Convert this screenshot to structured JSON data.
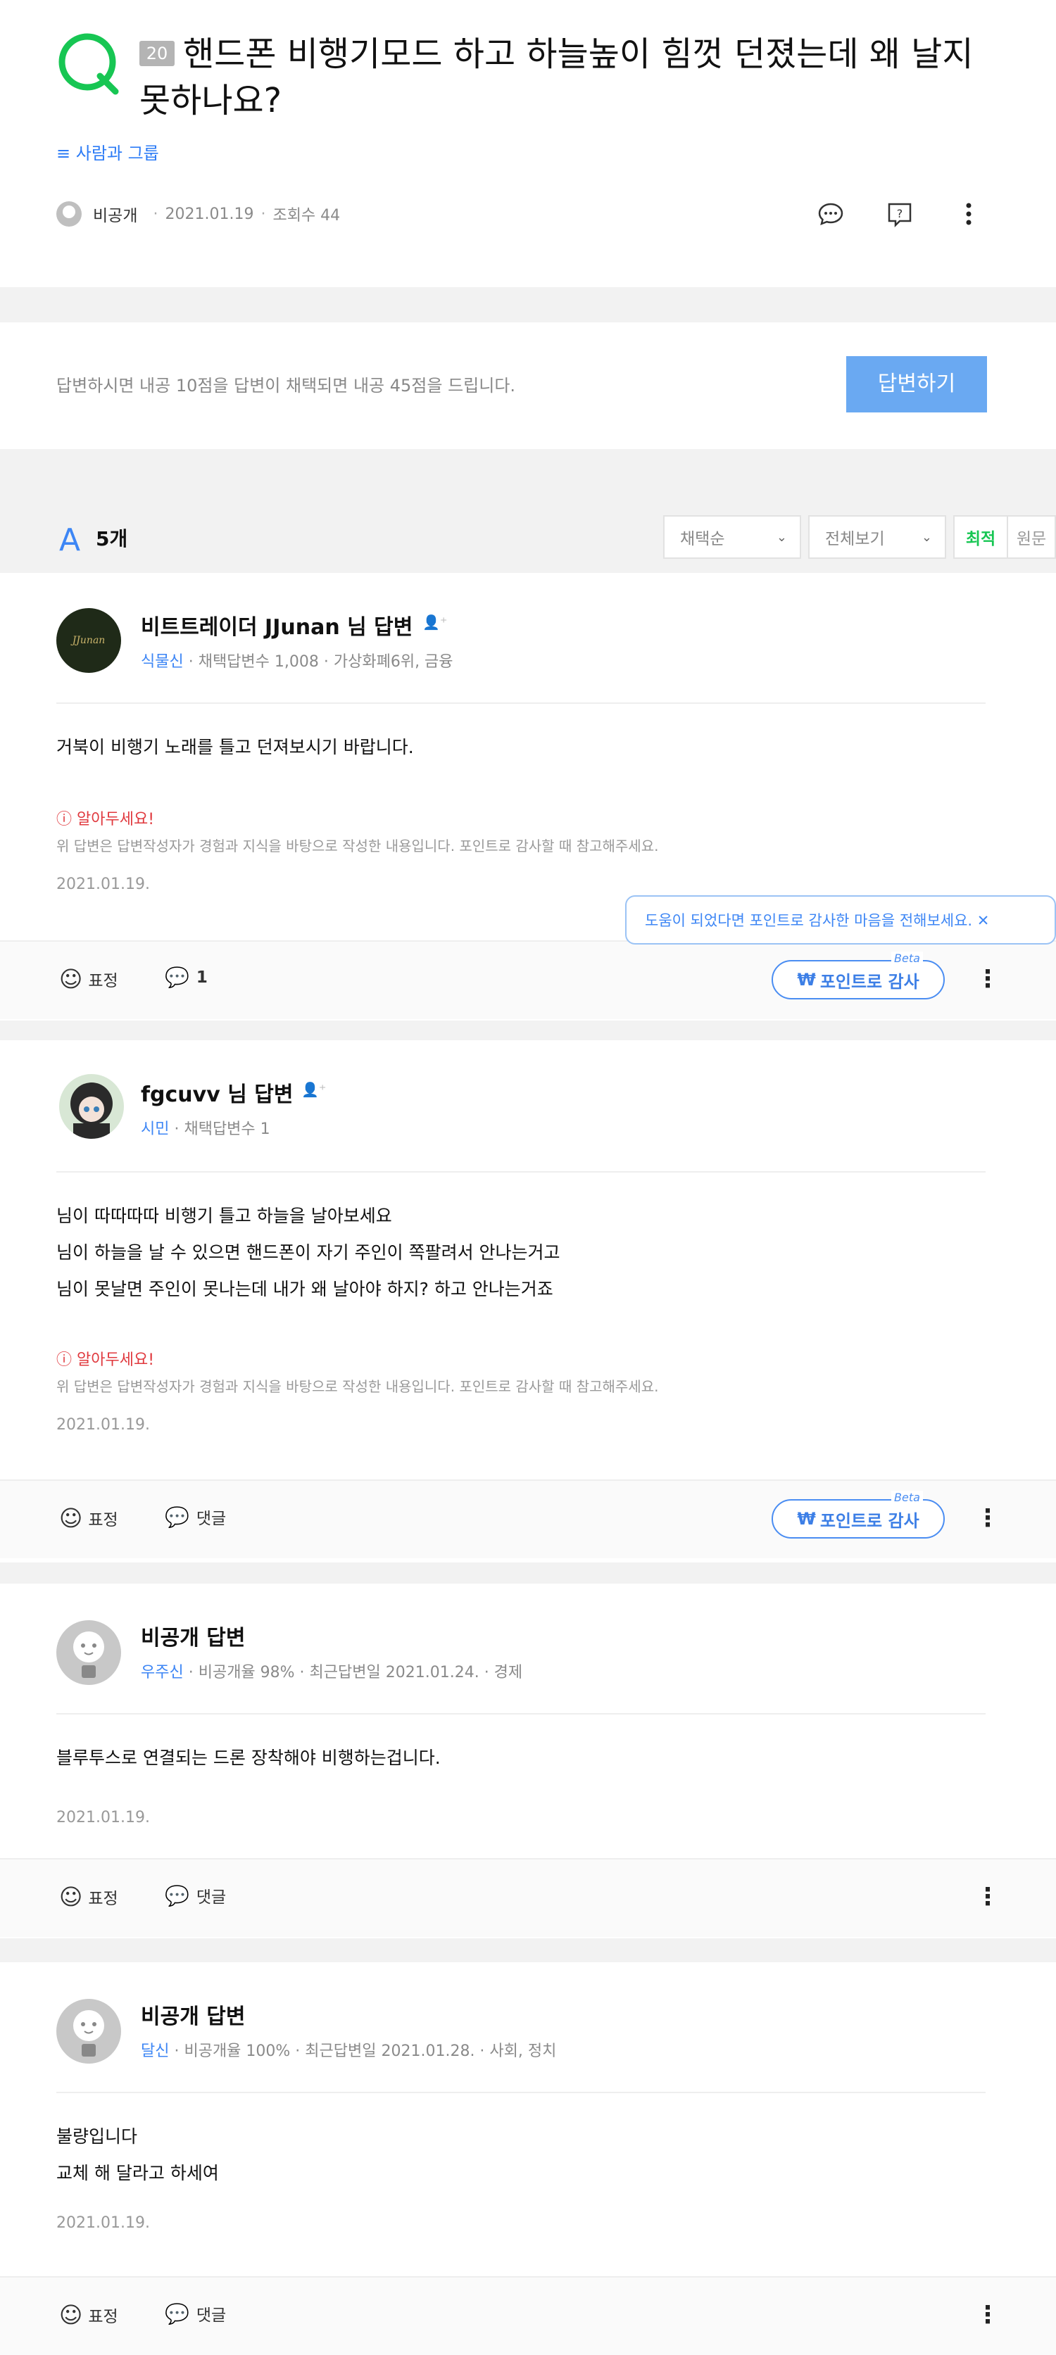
{
  "question": {
    "badge": "20",
    "title": "핸드폰 비행기모드 하고 하늘높이 힘껏 던졌는데 왜 날지못하나요?",
    "category": "≡ 사람과 그룹",
    "author": "비공개",
    "date": "2021.01.19",
    "views": "조회수 44"
  },
  "prompt": {
    "text": "답변하시면 내공 10점을 답변이 채택되면 내공 45점을 드립니다.",
    "answer_button": "답변하기"
  },
  "answers_header": {
    "mark": "A",
    "count": "5개",
    "sort1": "채택순",
    "sort2": "전체보기",
    "tab_latest": "최적",
    "tab_original": "원문"
  },
  "labels": {
    "emotion": "표정",
    "comment": "댓글",
    "point_thanks": "포인트로 감사",
    "beta": "Beta",
    "notice_title": "알아두세요!",
    "notice_text": "위 답변은 답변작성자가 경험과 지식을 바탕으로 작성한 내용입니다. 포인트로 감사할 때 참고해주세요.",
    "tooltip": "도움이 되었다면 포인트로 감사한 마음을 전해보세요. ✕"
  },
  "answers": [
    {
      "name": "비트트레이더 JJunan 님 답변",
      "level": "식물신",
      "meta": " · 채택답변수 1,008 · 가상화폐6위, 금융",
      "lines": [
        "거북이 비행기 노래를 틀고 던져보시기 바랍니다."
      ],
      "date": "2021.01.19.",
      "comment_count": "1",
      "avatar_text": "JJunan"
    },
    {
      "name": "fgcuvv 님 답변",
      "level": "시민",
      "meta": " · 채택답변수 1",
      "lines": [
        "님이 따따따따 비행기 틀고 하늘을 날아보세요",
        "님이 하늘을 날 수 있으면 핸드폰이 자기 주인이 쪽팔려서 안나는거고",
        "님이 못날면 주인이 못나는데 내가 왜 날아야 하지? 하고 안나는거죠"
      ],
      "date": "2021.01.19."
    },
    {
      "name": "비공개 답변",
      "level": "우주신",
      "meta": " · 비공개율 98% · 최근답변일 2021.01.24. · 경제",
      "lines": [
        "블루투스로 연결되는 드론 장착해야 비행하는겁니다."
      ],
      "date": "2021.01.19."
    },
    {
      "name": "비공개 답변",
      "level": "달신",
      "meta": " · 비공개율 100% · 최근답변일 2021.01.28. · 사회, 정치",
      "lines": [
        "불량입니다",
        "교체 해 달라고 하세여"
      ],
      "date": "2021.01.19."
    }
  ]
}
